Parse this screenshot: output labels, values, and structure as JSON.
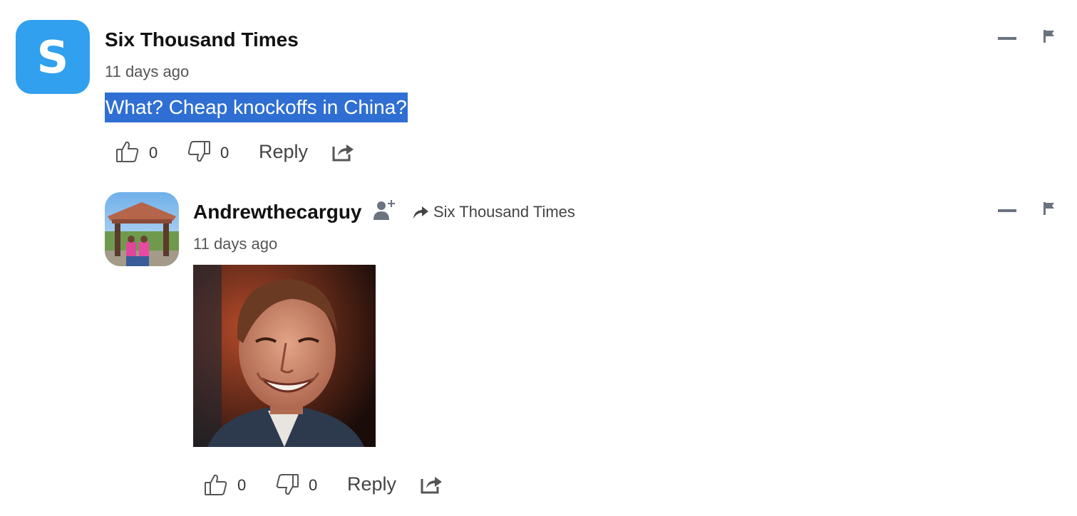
{
  "comments": [
    {
      "avatar_letter": "S",
      "avatar_color": "#31a0ef",
      "author": "Six Thousand Times",
      "time": "11 days ago",
      "text": "What? Cheap knockoffs in China?",
      "text_selected": true,
      "upvotes": "0",
      "downvotes": "0",
      "reply_label": "Reply"
    },
    {
      "author": "Andrewthecarguy",
      "replying_to": "Six Thousand Times",
      "time": "11 days ago",
      "media": "gif-image",
      "upvotes": "0",
      "downvotes": "0",
      "reply_label": "Reply"
    }
  ],
  "colors": {
    "selection": "#2f6fd3",
    "icon_gray": "#6b7280"
  },
  "icons": [
    "thumbs-up-icon",
    "thumbs-down-icon",
    "share-icon",
    "collapse-icon",
    "flag-icon",
    "follow-user-icon",
    "reply-arrow-icon"
  ]
}
